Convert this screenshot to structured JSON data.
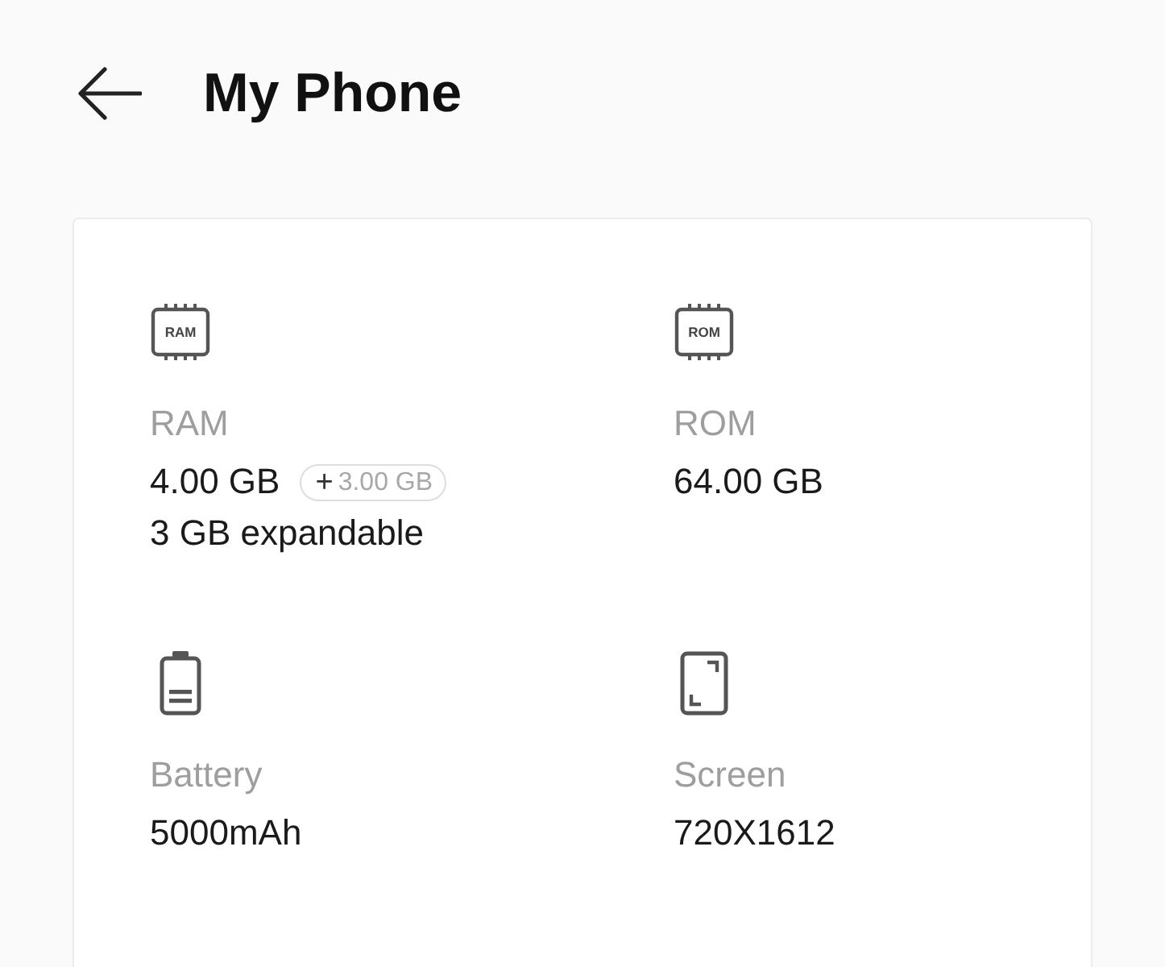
{
  "header": {
    "title": "My Phone"
  },
  "specs": [
    {
      "kind": "chip",
      "icon_text": "RAM",
      "label": "RAM",
      "value": "4.00 GB",
      "badge": {
        "sign": "+",
        "amount": "3.00 GB"
      },
      "note": "3 GB expandable"
    },
    {
      "kind": "chip",
      "icon_text": "ROM",
      "label": "ROM",
      "value": "64.00 GB"
    },
    {
      "kind": "battery",
      "label": "Battery",
      "value": "5000mAh"
    },
    {
      "kind": "screen",
      "label": "Screen",
      "value": "720X1612"
    }
  ]
}
